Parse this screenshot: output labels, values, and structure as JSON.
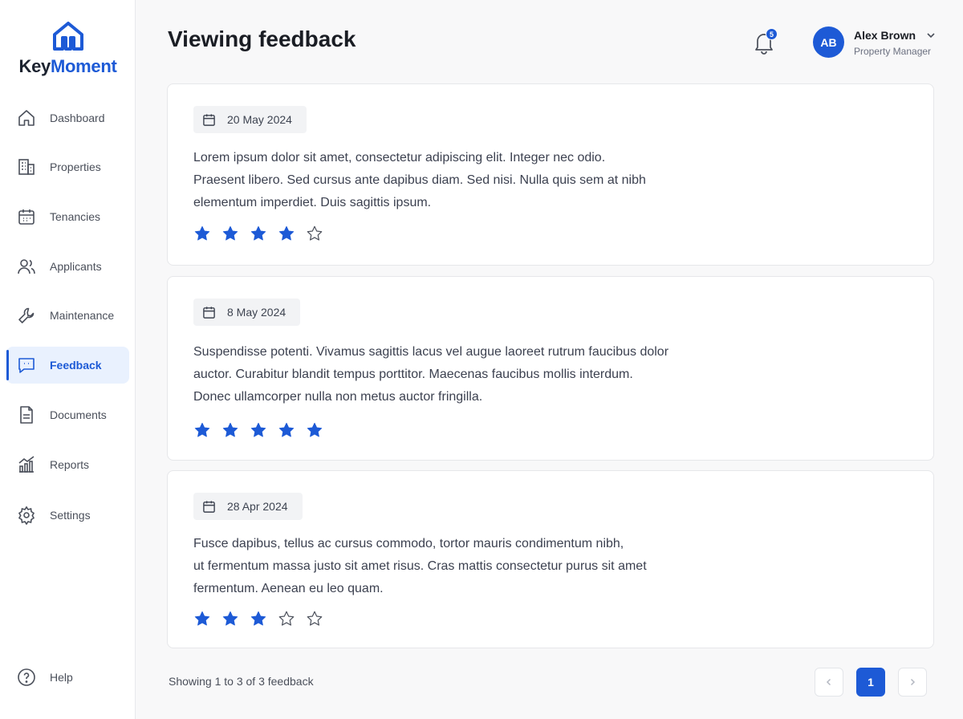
{
  "app": {
    "logo_key": "Key",
    "logo_moment": "Moment",
    "logo_icon": "house-icon",
    "accent_color": "#1d5ad6"
  },
  "sidebar": {
    "items": [
      {
        "label": "Dashboard",
        "icon": "home-icon",
        "active": false
      },
      {
        "label": "Properties",
        "icon": "building-icon",
        "active": false
      },
      {
        "label": "Tenancies",
        "icon": "calendar-icon",
        "active": false
      },
      {
        "label": "Applicants",
        "icon": "users-icon",
        "active": false
      },
      {
        "label": "Maintenance",
        "icon": "wrench-icon",
        "active": false
      },
      {
        "label": "Feedback",
        "icon": "message-icon",
        "active": true
      },
      {
        "label": "Documents",
        "icon": "document-icon",
        "active": false
      },
      {
        "label": "Reports",
        "icon": "chart-icon",
        "active": false
      },
      {
        "label": "Settings",
        "icon": "gear-icon",
        "active": false
      }
    ],
    "help_label": "Help"
  },
  "header": {
    "title": "Viewing feedback",
    "notification_count": "5",
    "user": {
      "initials": "AB",
      "name": "Alex Brown",
      "role": "Property Manager"
    }
  },
  "feedback": [
    {
      "date": "20 May 2024",
      "lines": [
        "Lorem ipsum dolor sit amet, consectetur adipiscing elit. Integer nec odio.",
        "Praesent libero. Sed cursus ante dapibus diam. Sed nisi. Nulla quis sem at nibh",
        "elementum imperdiet. Duis sagittis ipsum."
      ],
      "rating": 4,
      "max_rating": 5
    },
    {
      "date": "8 May 2024",
      "lines": [
        "Suspendisse potenti. Vivamus sagittis lacus vel augue laoreet rutrum faucibus dolor",
        "auctor. Curabitur blandit tempus porttitor. Maecenas faucibus mollis interdum.",
        "Donec ullamcorper nulla non metus auctor fringilla."
      ],
      "rating": 5,
      "max_rating": 5
    },
    {
      "date": "28 Apr 2024",
      "lines": [
        "Fusce dapibus, tellus ac cursus commodo, tortor mauris condimentum nibh,",
        "ut fermentum massa justo sit amet risus. Cras mattis consectetur purus sit amet",
        "fermentum. Aenean eu leo quam."
      ],
      "rating": 3,
      "max_rating": 5
    }
  ],
  "pagination": {
    "summary": "Showing 1 to 3 of 3 feedback",
    "current_page": "1"
  }
}
